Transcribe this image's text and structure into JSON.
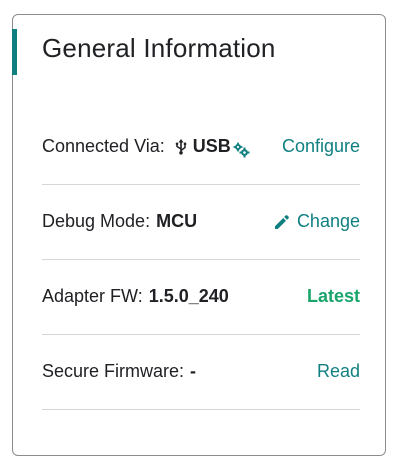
{
  "card": {
    "title": "General Information"
  },
  "rows": {
    "connected": {
      "label": "Connected Via:",
      "value": "USB",
      "action": "Configure"
    },
    "debug": {
      "label": "Debug Mode:",
      "value": "MCU",
      "action": "Change"
    },
    "adapter": {
      "label": "Adapter FW:",
      "value": "1.5.0_240",
      "status": "Latest"
    },
    "secure": {
      "label": "Secure Firmware:",
      "value": "-",
      "action": "Read"
    }
  },
  "icons": {
    "usb": "usb-icon",
    "gear": "gear-icon",
    "pencil": "pencil-icon"
  },
  "colors": {
    "accent": "#0f7f80",
    "status_ok": "#1aa56b",
    "text": "#202124",
    "border": "#8c8c8c",
    "divider": "#d6d6d6"
  }
}
